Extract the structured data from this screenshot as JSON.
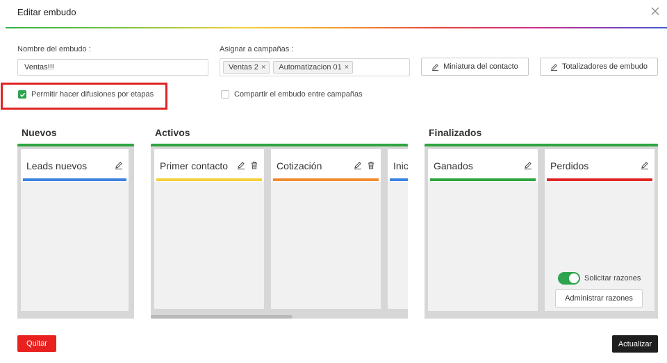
{
  "dialog": {
    "title": "Editar embudo"
  },
  "form": {
    "name_label": "Nombre del embudo",
    "name_value": "Ventas!!!",
    "campaigns_label": "Asignar a campañas",
    "campaign_tags": [
      "Ventas 2",
      "Automatizacion 01"
    ],
    "tag_remove": "×",
    "thumbnail_button": "Miniatura del contacto",
    "totals_button": "Totalizadores de embudo",
    "broadcast_checkbox": {
      "label": "Permitir hacer difusiones por etapas",
      "checked": true
    },
    "share_checkbox": {
      "label": "Compartir el embudo entre campañas",
      "checked": false
    }
  },
  "groups": {
    "nuevos": {
      "title": "Nuevos",
      "color": "#2ea43f"
    },
    "activos": {
      "title": "Activos",
      "color": "#2ea43f"
    },
    "finalizados": {
      "title": "Finalizados",
      "color": "#2ea43f"
    }
  },
  "stages": {
    "leads_nuevos": {
      "name": "Leads nuevos",
      "color": "#3b82e0"
    },
    "primer_contacto": {
      "name": "Primer contacto",
      "color": "#f4d03a"
    },
    "cotizacion": {
      "name": "Cotización",
      "color": "#f28a2e"
    },
    "inic": {
      "name": "Inic",
      "color": "#3b82e0"
    },
    "ganados": {
      "name": "Ganados",
      "color": "#2ea43f"
    },
    "perdidos": {
      "name": "Perdidos",
      "color": "#e02424"
    }
  },
  "lost": {
    "request_reasons_label": "Solicitar razones",
    "request_reasons_on": true,
    "manage_reasons_button": "Administrar razones"
  },
  "footer": {
    "quit_button": "Quitar",
    "update_button": "Actualizar"
  },
  "icons": [
    "close-icon",
    "pencil-icon",
    "trash-icon",
    "check-icon"
  ]
}
